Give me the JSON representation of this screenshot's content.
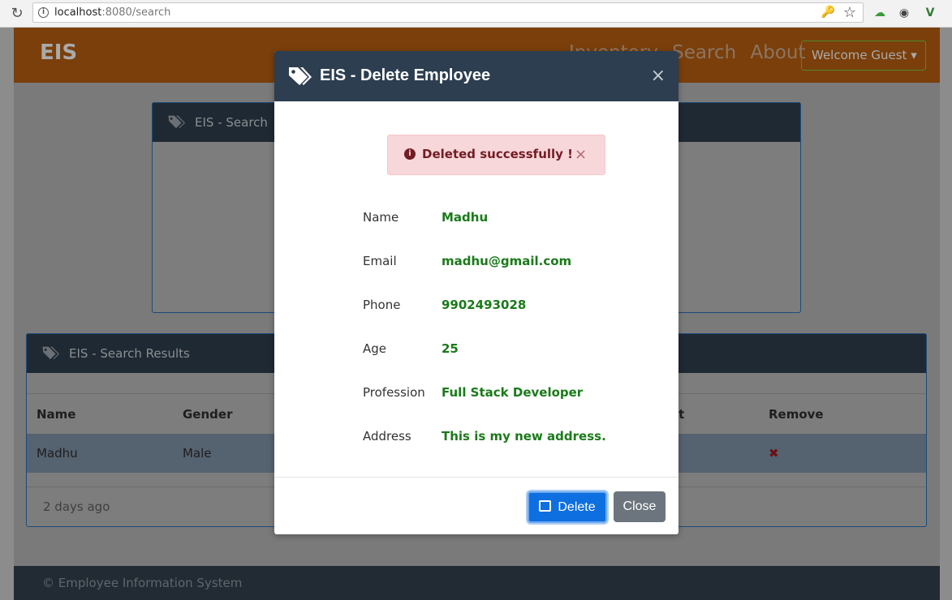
{
  "browser": {
    "url_host": "localhost",
    "url_path": ":8080/search"
  },
  "navbar": {
    "brand": "EIS",
    "links": [
      "Inventory",
      "Search",
      "About"
    ],
    "welcome": "Welcome Guest"
  },
  "search_card": {
    "title": "EIS - Search"
  },
  "results_card": {
    "title": "EIS - Search Results",
    "columns": [
      "Name",
      "Gender",
      "Edit",
      "Remove"
    ],
    "row": {
      "name": "Madhu",
      "gender": "Male"
    },
    "footer_text": "2 days ago"
  },
  "footer": {
    "text": "© Employee Information System"
  },
  "modal": {
    "title": "EIS - Delete Employee",
    "alert_text": "Deleted successfully !",
    "fields": [
      {
        "label": "Name",
        "value": "Madhu"
      },
      {
        "label": "Email",
        "value": "madhu@gmail.com"
      },
      {
        "label": "Phone",
        "value": "9902493028"
      },
      {
        "label": "Age",
        "value": "25"
      },
      {
        "label": "Profession",
        "value": "Full Stack Developer"
      },
      {
        "label": "Address",
        "value": "This is my new address."
      }
    ],
    "delete_label": "Delete",
    "close_label": "Close"
  }
}
